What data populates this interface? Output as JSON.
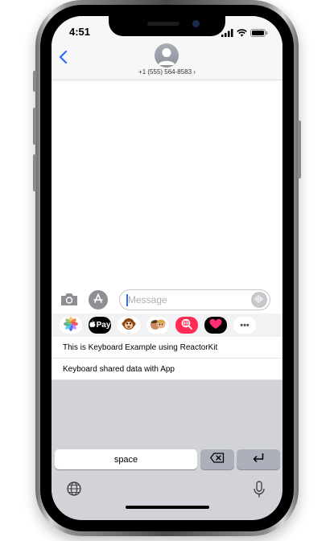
{
  "status_bar": {
    "time": "4:51"
  },
  "conversation": {
    "contact": "+1 (555) 564-8583 ›"
  },
  "composer": {
    "placeholder": "Message"
  },
  "app_strip": {
    "apple_pay_label": "Pay",
    "more_label": "•••"
  },
  "keyboard": {
    "suggestions": [
      "This is Keyboard Example using ReactorKit",
      "Keyboard shared data with App"
    ],
    "space_label": "space"
  },
  "colors": {
    "accent": "#2f6bff",
    "key_dark": "#abb0ba",
    "keyboard_bg": "#d1d3d8",
    "pink": "#ff2d55"
  },
  "icons": [
    "back-chevron-icon",
    "signal-icon",
    "wifi-icon",
    "battery-icon",
    "person-icon",
    "camera-icon",
    "app-store-icon",
    "audio-wave-icon",
    "photos-icon",
    "apple-logo-icon",
    "monkey-emoji-icon",
    "memoji-icon",
    "search-globe-icon",
    "heart-icon",
    "delete-key-icon",
    "return-arrow-icon",
    "globe-icon",
    "microphone-icon"
  ]
}
